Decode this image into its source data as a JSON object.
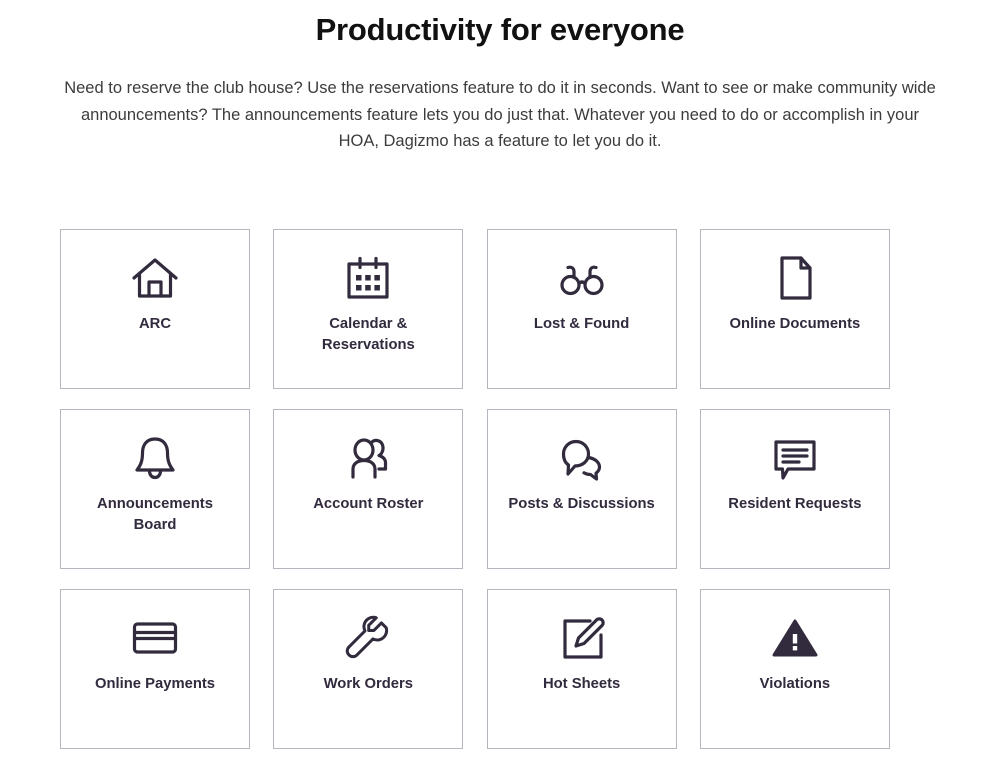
{
  "header": {
    "title": "Productivity for everyone",
    "intro": "Need to reserve the club house? Use the reservations feature to do it in seconds. Want to see or make community wide announcements? The announcements feature lets you do just that. Whatever you need to do or accomplish in your HOA, Dagizmo has a feature to let you do it."
  },
  "colors": {
    "title_text": "#111111",
    "body_text": "#3c3c3c",
    "icon": "#322a3d",
    "label_text": "#322a3d",
    "card_border": "#b6b6bf",
    "background": "#ffffff"
  },
  "features": [
    {
      "label": "ARC",
      "icon": "house-icon"
    },
    {
      "label": "Calendar &\nReservations",
      "icon": "calendar-icon"
    },
    {
      "label": "Lost & Found",
      "icon": "glasses-icon"
    },
    {
      "label": "Online Documents",
      "icon": "document-icon"
    },
    {
      "label": "Announcements\nBoard",
      "icon": "bell-icon"
    },
    {
      "label": "Account Roster",
      "icon": "users-icon"
    },
    {
      "label": "Posts & Discussions",
      "icon": "speech-bubbles-icon"
    },
    {
      "label": "Resident Requests",
      "icon": "message-lines-icon"
    },
    {
      "label": "Online Payments",
      "icon": "credit-card-icon"
    },
    {
      "label": "Work Orders",
      "icon": "wrench-icon"
    },
    {
      "label": "Hot Sheets",
      "icon": "edit-square-icon"
    },
    {
      "label": "Violations",
      "icon": "warning-triangle-icon"
    }
  ]
}
